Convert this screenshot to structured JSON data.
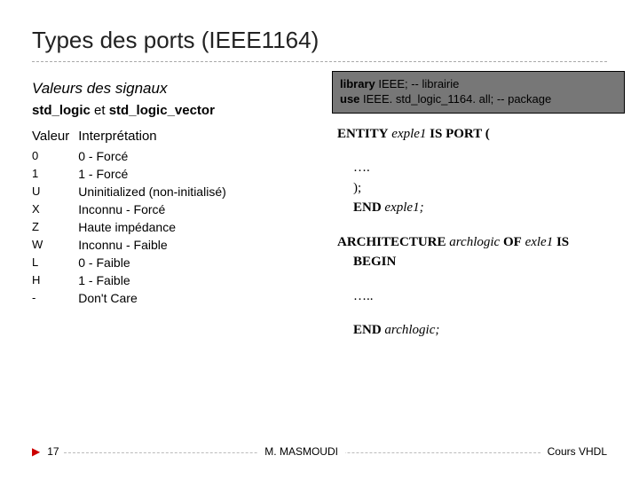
{
  "title": "Types des ports (IEEE1164)",
  "library_block": {
    "line1_kw": "library",
    "line1_rest": " IEEE; -- librairie",
    "line2_kw": "use",
    "line2_rest": " IEEE. std_logic_1164. all; -- package"
  },
  "sub_header": "Valeurs des signaux",
  "desc_parts": {
    "a": "std_logic",
    "b": " et ",
    "c": "std_logic_vector"
  },
  "table": {
    "head_value": "Valeur",
    "head_interp": "Interprétation",
    "rows": [
      {
        "sym": "0",
        "txt": "0 - Forcé"
      },
      {
        "sym": "1",
        "txt": "1 - Forcé"
      },
      {
        "sym": "U",
        "txt": "Uninitialized (non-initialisé)"
      },
      {
        "sym": "X",
        "txt": "Inconnu - Forcé"
      },
      {
        "sym": "Z",
        "txt": "Haute impédance"
      },
      {
        "sym": "W",
        "txt": "Inconnu - Faible"
      },
      {
        "sym": "L",
        "txt": "0 - Faible"
      },
      {
        "sym": "H",
        "txt": "1 - Faible"
      },
      {
        "sym": "-",
        "txt": "Don't Care"
      }
    ]
  },
  "vhdl": {
    "entity_kw1": "ENTITY",
    "entity_name": " exple1 ",
    "entity_kw2": "IS PORT (",
    "dots1": "….",
    "close_paren": ");",
    "end_kw": "END",
    "end_name": " exple1;",
    "arch_kw1": "ARCHITECTURE",
    "arch_name": " archlogic ",
    "arch_kw2": "OF",
    "arch_ent": " exle1 ",
    "arch_kw3": "IS",
    "begin_kw": "BEGIN",
    "dots2": "…..",
    "end2_kw": "END",
    "end2_name": " archlogic;"
  },
  "footer": {
    "page": "17",
    "author": "M. MASMOUDI",
    "course": "Cours VHDL"
  }
}
